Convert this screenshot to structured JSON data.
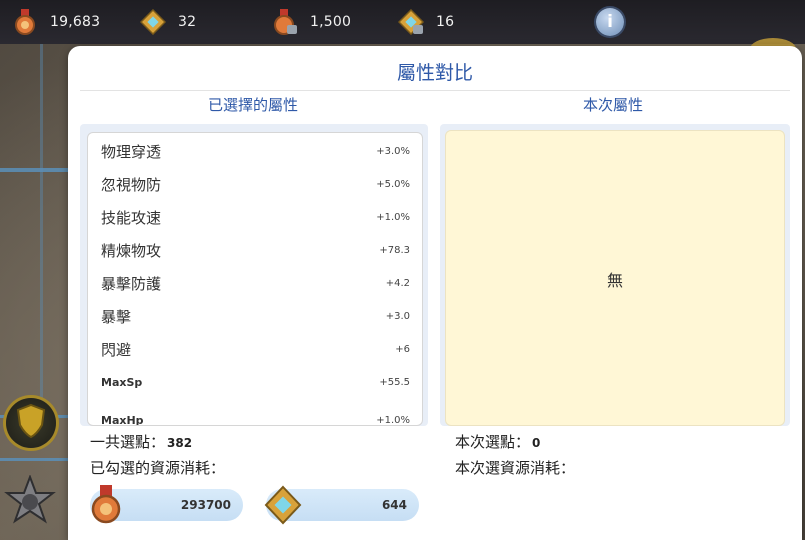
{
  "topbar": {
    "resources": [
      {
        "icon": "medal-icon",
        "value": "19,683"
      },
      {
        "icon": "gem-cluster-icon",
        "value": "32"
      },
      {
        "icon": "locked-medal-icon",
        "value": "1,500"
      },
      {
        "icon": "locked-gem-cluster-icon",
        "value": "16"
      }
    ],
    "info_label": "i"
  },
  "dialog": {
    "title": "屬性對比",
    "left_header": "已選擇的屬性",
    "right_header": "本次屬性",
    "stats": [
      {
        "name": "物理穿透",
        "value": "+3.0%"
      },
      {
        "name": "忽視物防",
        "value": "+5.0%"
      },
      {
        "name": "技能攻速",
        "value": "+1.0%"
      },
      {
        "name": "精煉物攻",
        "value": "+78.3"
      },
      {
        "name": "暴擊防護",
        "value": "+4.2"
      },
      {
        "name": "暴擊",
        "value": "+3.0"
      },
      {
        "name": "閃避",
        "value": "+6"
      },
      {
        "name": "MaxSp",
        "value": "+55.5"
      },
      {
        "name": "MaxHp",
        "value": "+1.0%"
      }
    ],
    "current_none": "無",
    "total_points_label": "一共選點：",
    "total_points_value": "382",
    "selected_cost_label": "已勾選的資源消耗：",
    "current_points_label": "本次選點：",
    "current_points_value": "0",
    "current_cost_label": "本次選資源消耗：",
    "costs": [
      {
        "icon": "medal-icon",
        "value": "293700"
      },
      {
        "icon": "gem-cluster-icon",
        "value": "644"
      }
    ]
  },
  "colors": {
    "accent": "#2f59a8",
    "panel_bg": "#e8eef7",
    "none_box_bg": "#fff7d6",
    "pill_bg": "#c6def4"
  }
}
